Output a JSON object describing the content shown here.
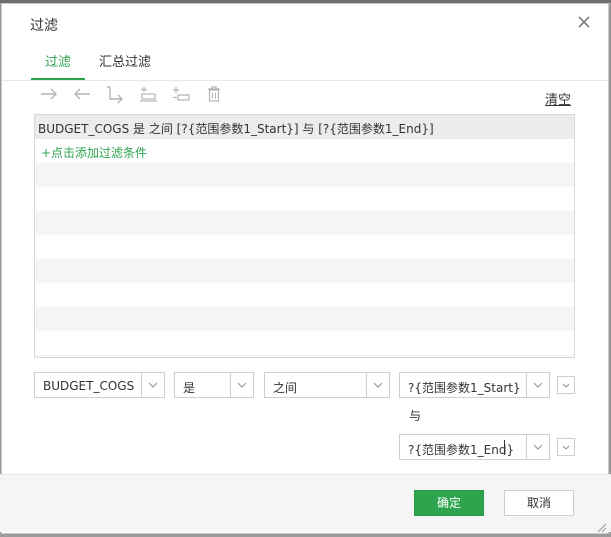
{
  "dialog": {
    "title": "过滤"
  },
  "tabs": [
    {
      "label": "过滤",
      "active": true
    },
    {
      "label": "汇总过滤",
      "active": false
    }
  ],
  "toolbar": {
    "icons": [
      "arrow-right-icon",
      "arrow-left-icon",
      "bracket-arrow-icon",
      "insert-condition-icon",
      "append-condition-icon",
      "delete-icon"
    ],
    "clear_label": "清空"
  },
  "conditions": {
    "rows": [
      "BUDGET_COGS 是 之间 [?{范围参数1_Start}] 与 [?{范围参数1_End}]"
    ],
    "add_label": "+点击添加过滤条件"
  },
  "editor": {
    "field_value": "BUDGET_COGS",
    "operator_value": "是",
    "comparison_value": "之间",
    "start_value": "?{范围参数1_Start}",
    "and_label": "与",
    "end_value": "?{范围参数1_End}"
  },
  "footer": {
    "ok_label": "确定",
    "cancel_label": "取消"
  },
  "colors": {
    "accent": "#2ea44f",
    "border": "#cfcfcf",
    "stripe": "#f5f5f5"
  }
}
